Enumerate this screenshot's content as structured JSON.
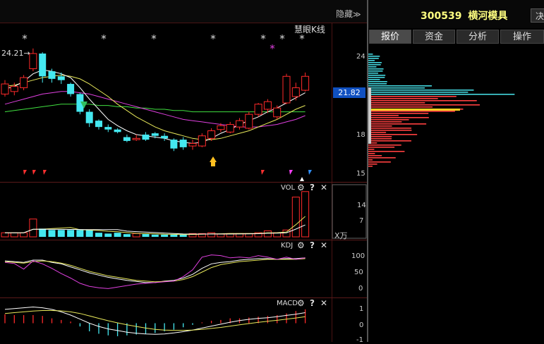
{
  "header": {
    "hide_label": "隐藏",
    "hide_arrows": "≫",
    "stock_code": "300539",
    "stock_name": "横河模具",
    "truncated_button": "决"
  },
  "tabs": [
    {
      "label": "报价",
      "active": true
    },
    {
      "label": "资金",
      "active": false
    },
    {
      "label": "分析",
      "active": false
    },
    {
      "label": "操作",
      "active": false
    }
  ],
  "kline": {
    "indicator_label": "慧眼K线",
    "high_marker": "24.21→",
    "current_price": "21.82",
    "price_ticks": [
      "24",
      "18",
      "15"
    ],
    "star_glyph": "*"
  },
  "vol": {
    "label": "VOL",
    "ticks": [
      "14",
      "7"
    ],
    "unit": "X万"
  },
  "kdj": {
    "label": "KDJ",
    "ticks": [
      "100",
      "50",
      "0"
    ]
  },
  "macd": {
    "label": "MACD",
    "ticks": [
      "1",
      "0",
      "-1"
    ]
  },
  "panel_icons": {
    "settings": "⚙",
    "help": "?",
    "close": "✕"
  },
  "colors": {
    "up": "#ff2a2a",
    "down": "#44e8f0",
    "ma5": "#ffffff",
    "ma10": "#e8e85a",
    "ma20": "#e040e0",
    "ma60": "#40e040",
    "current_price_bg": "#1050c0",
    "stock_title": "#ffff80"
  },
  "chart_data": [
    {
      "type": "candlestick",
      "title": "",
      "candles": [
        {
          "o": 21.0,
          "c": 21.8,
          "h": 22.1,
          "l": 20.8
        },
        {
          "o": 21.2,
          "c": 21.6,
          "h": 21.9,
          "l": 20.9
        },
        {
          "o": 21.5,
          "c": 22.3,
          "h": 22.5,
          "l": 21.3
        },
        {
          "o": 23.0,
          "c": 24.2,
          "h": 24.6,
          "l": 22.8
        },
        {
          "o": 24.2,
          "c": 22.4,
          "h": 24.3,
          "l": 21.9
        },
        {
          "o": 22.8,
          "c": 22.2,
          "h": 23.0,
          "l": 21.9
        },
        {
          "o": 22.4,
          "c": 22.1,
          "h": 22.7,
          "l": 21.8
        },
        {
          "o": 21.8,
          "c": 21.0,
          "h": 21.9,
          "l": 20.8
        },
        {
          "o": 21.0,
          "c": 19.6,
          "h": 21.1,
          "l": 19.4
        },
        {
          "o": 19.6,
          "c": 18.7,
          "h": 19.8,
          "l": 18.4
        },
        {
          "o": 18.9,
          "c": 18.4,
          "h": 19.0,
          "l": 18.2
        },
        {
          "o": 18.4,
          "c": 18.2,
          "h": 18.6,
          "l": 18.0
        },
        {
          "o": 18.2,
          "c": 18.0,
          "h": 18.3,
          "l": 17.9
        },
        {
          "o": 17.6,
          "c": 17.3,
          "h": 17.8,
          "l": 17.2
        },
        {
          "o": 17.4,
          "c": 17.5,
          "h": 17.8,
          "l": 17.3
        },
        {
          "o": 17.8,
          "c": 17.4,
          "h": 18.0,
          "l": 17.3
        },
        {
          "o": 17.9,
          "c": 17.7,
          "h": 18.0,
          "l": 17.5
        },
        {
          "o": 17.7,
          "c": 17.5,
          "h": 17.9,
          "l": 17.3
        },
        {
          "o": 17.4,
          "c": 16.7,
          "h": 17.5,
          "l": 16.5
        },
        {
          "o": 17.4,
          "c": 16.8,
          "h": 17.6,
          "l": 16.6
        },
        {
          "o": 16.9,
          "c": 17.1,
          "h": 17.4,
          "l": 16.6
        },
        {
          "o": 16.9,
          "c": 17.7,
          "h": 17.9,
          "l": 16.8
        },
        {
          "o": 17.5,
          "c": 18.1,
          "h": 18.3,
          "l": 17.3
        },
        {
          "o": 18.2,
          "c": 18.5,
          "h": 18.7,
          "l": 18.0
        },
        {
          "o": 18.0,
          "c": 18.6,
          "h": 18.8,
          "l": 17.9
        },
        {
          "o": 18.4,
          "c": 18.9,
          "h": 19.1,
          "l": 18.2
        },
        {
          "o": 18.3,
          "c": 19.4,
          "h": 19.6,
          "l": 18.2
        },
        {
          "o": 19.4,
          "c": 20.2,
          "h": 20.3,
          "l": 19.2
        },
        {
          "o": 19.8,
          "c": 20.4,
          "h": 20.6,
          "l": 19.5
        },
        {
          "o": 19.2,
          "c": 19.9,
          "h": 20.1,
          "l": 19.0
        },
        {
          "o": 20.3,
          "c": 22.4,
          "h": 22.6,
          "l": 20.2
        },
        {
          "o": 20.8,
          "c": 21.5,
          "h": 21.9,
          "l": 20.5
        },
        {
          "o": 21.3,
          "c": 22.4,
          "h": 22.7,
          "l": 21.2
        }
      ],
      "ma5": [
        21.4,
        21.6,
        22.0,
        22.6,
        22.9,
        22.8,
        22.6,
        22.3,
        21.5,
        20.6,
        19.8,
        19.0,
        18.5,
        18.1,
        17.8,
        17.7,
        17.6,
        17.5,
        17.3,
        17.2,
        17.1,
        17.2,
        17.5,
        17.9,
        18.2,
        18.6,
        18.9,
        19.2,
        19.6,
        19.9,
        20.3,
        20.7,
        21.1
      ],
      "ma10": [
        21.6,
        21.7,
        21.9,
        22.1,
        22.3,
        22.4,
        22.5,
        22.4,
        22.2,
        21.8,
        21.3,
        20.8,
        20.2,
        19.7,
        19.2,
        18.8,
        18.4,
        18.1,
        17.9,
        17.7,
        17.5,
        17.4,
        17.4,
        17.5,
        17.7,
        17.9,
        18.1,
        18.4,
        18.7,
        19.0,
        19.4,
        19.8,
        20.1
      ],
      "ma20": [
        20.2,
        20.4,
        20.6,
        20.8,
        21.0,
        21.1,
        21.2,
        21.2,
        21.1,
        21.0,
        20.8,
        20.6,
        20.4,
        20.2,
        20.0,
        19.8,
        19.6,
        19.4,
        19.2,
        19.0,
        18.9,
        18.8,
        18.7,
        18.6,
        18.5,
        18.4,
        18.4,
        18.4,
        18.5,
        18.6,
        18.8,
        19.0,
        19.3
      ],
      "ma60": [
        19.6,
        19.7,
        19.8,
        19.9,
        20.0,
        20.1,
        20.2,
        20.2,
        20.2,
        20.2,
        20.1,
        20.1,
        20.0,
        20.0,
        19.9,
        19.9,
        19.8,
        19.8,
        19.7,
        19.7,
        19.6,
        19.6,
        19.6,
        19.6,
        19.6,
        19.6,
        19.6,
        19.6,
        19.6,
        19.6,
        19.6,
        19.6,
        19.6
      ],
      "ylim": [
        14.4,
        26.2
      ]
    },
    {
      "type": "bar",
      "title": "VOL",
      "values": [
        1.5,
        1.5,
        1.5,
        6.5,
        3.0,
        2.5,
        2.5,
        2.5,
        2.5,
        2.5,
        1.5,
        1.2,
        1.5,
        1.0,
        1.2,
        1.0,
        0.8,
        0.8,
        0.8,
        0.8,
        1.2,
        1.2,
        1.5,
        1.0,
        1.2,
        1.2,
        1.2,
        1.5,
        2.2,
        1.5,
        2.5,
        14.5,
        16.5
      ],
      "ylim": [
        0,
        18.5
      ]
    },
    {
      "type": "line",
      "title": "KDJ",
      "series": [
        {
          "values": [
            82,
            80,
            78,
            84,
            84,
            78,
            74,
            66,
            58,
            50,
            44,
            38,
            34,
            30,
            27,
            24,
            24,
            28,
            30,
            36,
            46,
            62,
            74,
            78,
            80,
            84,
            86,
            88,
            88,
            86,
            88,
            88,
            90
          ]
        },
        {
          "values": [
            80,
            78,
            76,
            80,
            82,
            80,
            76,
            70,
            62,
            54,
            48,
            42,
            38,
            34,
            30,
            28,
            26,
            27,
            28,
            32,
            40,
            52,
            64,
            72,
            76,
            80,
            82,
            84,
            86,
            86,
            86,
            86,
            88
          ]
        },
        {
          "values": [
            78,
            75,
            60,
            82,
            74,
            62,
            48,
            36,
            22,
            14,
            10,
            8,
            12,
            16,
            20,
            22,
            24,
            26,
            28,
            40,
            58,
            92,
            98,
            96,
            90,
            92,
            90,
            96,
            92,
            86,
            92,
            86,
            90
          ]
        }
      ],
      "ylim": [
        -12,
        116
      ]
    },
    {
      "type": "bar",
      "title": "MACD",
      "values": [
        0.55,
        0.5,
        0.5,
        0.5,
        0.45,
        0.3,
        0.2,
        0.1,
        -0.2,
        -0.5,
        -0.65,
        -0.75,
        -0.8,
        -0.75,
        -0.7,
        -0.65,
        -0.6,
        -0.5,
        -0.4,
        -0.25,
        -0.1,
        0.05,
        0.15,
        0.2,
        0.3,
        0.3,
        0.35,
        0.4,
        0.45,
        0.5,
        0.6,
        0.75,
        0.85
      ],
      "dif": [
        0.85,
        0.9,
        0.95,
        1.0,
        0.95,
        0.85,
        0.7,
        0.5,
        0.25,
        0.0,
        -0.2,
        -0.35,
        -0.45,
        -0.55,
        -0.62,
        -0.66,
        -0.68,
        -0.66,
        -0.6,
        -0.52,
        -0.42,
        -0.3,
        -0.18,
        -0.06,
        0.06,
        0.16,
        0.24,
        0.3,
        0.34,
        0.4,
        0.48,
        0.55,
        0.65
      ],
      "dea": [
        0.6,
        0.65,
        0.7,
        0.75,
        0.78,
        0.78,
        0.76,
        0.7,
        0.6,
        0.45,
        0.3,
        0.15,
        0.02,
        -0.1,
        -0.2,
        -0.3,
        -0.38,
        -0.42,
        -0.44,
        -0.44,
        -0.42,
        -0.38,
        -0.32,
        -0.26,
        -0.18,
        -0.1,
        -0.02,
        0.05,
        0.12,
        0.18,
        0.25,
        0.32,
        0.4
      ],
      "ylim": [
        -1.15,
        1.15
      ]
    }
  ]
}
